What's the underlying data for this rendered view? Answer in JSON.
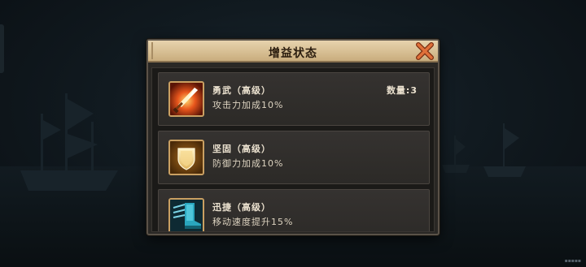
{
  "dialog": {
    "title": "增益状态",
    "close_icon": "close-x-icon"
  },
  "buffs": [
    {
      "name": "勇武（高级）",
      "description": "攻击力加成10%",
      "count_label": "数量:3",
      "icon": "flaming-sword-icon"
    },
    {
      "name": "坚固（高级）",
      "description": "防御力加成10%",
      "count_label": "",
      "icon": "golden-shield-icon"
    },
    {
      "name": "迅捷（高级）",
      "description": "移动速度提升15%",
      "count_label": "",
      "icon": "winged-boot-icon"
    }
  ],
  "colors": {
    "header_bg": "#d7bf93",
    "title_text": "#2a1c0e",
    "close_icon": "#d9622a",
    "icon_frame": "#caa062",
    "buff_text": "#ece2d0"
  }
}
